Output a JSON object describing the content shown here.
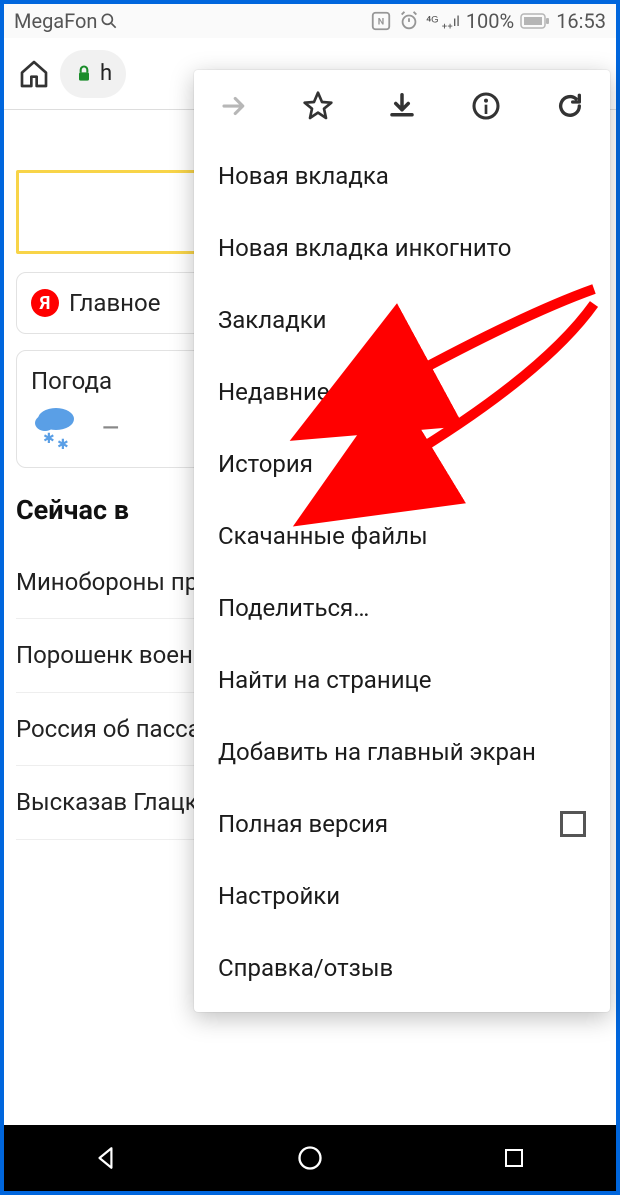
{
  "status_bar": {
    "carrier": "MegaFon",
    "battery_text": "100%",
    "time": "16:53"
  },
  "toolbar": {
    "url_fragment": "h"
  },
  "page": {
    "yandex_label": "Главное",
    "weather_label": "Погода",
    "section_header": "Сейчас в",
    "news": [
      "Минобороны провело п",
      "Порошенк военного",
      "Россия об пассажир",
      "Высказав Глацких п"
    ]
  },
  "menu": {
    "items": [
      "Новая вкладка",
      "Новая вкладка инкогнито",
      "Закладки",
      "Недавние вкладки",
      "История",
      "Скачанные файлы",
      "Поделиться…",
      "Найти на странице",
      "Добавить на главный экран",
      "Полная версия",
      "Настройки",
      "Справка/отзыв"
    ]
  }
}
